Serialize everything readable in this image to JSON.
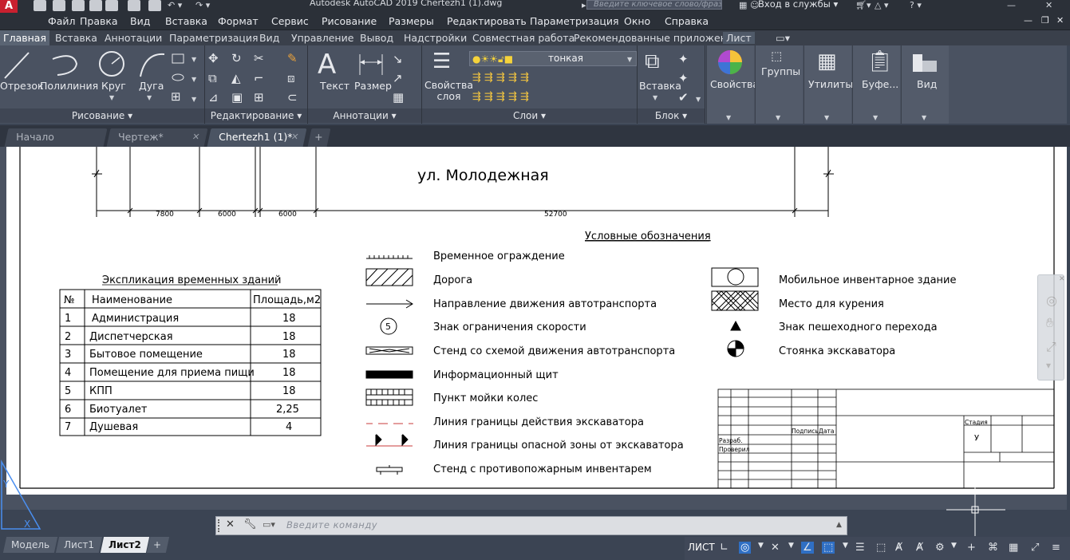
{
  "titlebar": {
    "app_logo": "A",
    "title": "Autodesk AutoCAD 2019    Chertezh1 (1).dwg",
    "search_placeholder": "Введите ключевое слово/фразу",
    "login": "Вход в службы"
  },
  "menu": [
    "Файл",
    "Правка",
    "Вид",
    "Вставка",
    "Формат",
    "Сервис",
    "Рисование",
    "Размеры",
    "Редактировать",
    "Параметризация",
    "Окно",
    "Справка"
  ],
  "ribbon_tabs": [
    "Главная",
    "Вставка",
    "Аннотации",
    "Параметризация",
    "Вид",
    "Управление",
    "Вывод",
    "Надстройки",
    "Совместная работа",
    "Рекомендованные приложения",
    "Лист"
  ],
  "ribbon": {
    "draw_buttons": [
      "Отрезок",
      "Полилиния",
      "Круг",
      "Дуга"
    ],
    "text_label": "Текст",
    "dimension_label": "Размер",
    "layer_properties": "Свойства\nслоя",
    "layer_current": "тонкая",
    "insert_label": "Вставка",
    "properties_label": "Свойства",
    "groups_label": "Группы",
    "utilities_label": "Утилиты",
    "clipboard_label": "Буфе...",
    "view_label": "Вид",
    "panels": {
      "draw": "Рисование",
      "modify": "Редактирование",
      "annotation": "Аннотации",
      "layers": "Слои",
      "block": "Блок"
    }
  },
  "doc_tabs": [
    {
      "label": "Начало",
      "active": false
    },
    {
      "label": "Чертеж*",
      "active": false
    },
    {
      "label": "Chertezh1 (1)*",
      "active": true
    }
  ],
  "drawing": {
    "street": "ул. Молодежная",
    "dims": [
      "7800",
      "6000",
      "6000",
      "52700"
    ],
    "legend_title": "Условные обозначения",
    "legend_left": [
      "Временное ограждение",
      "Дорога",
      "Направление движения автотранспорта",
      "Знак ограничения скорости",
      "Стенд со схемой движения автотранспорта",
      "Информационный щит",
      "Пункт мойки колес",
      "Линия границы действия экскаватора",
      "Линия границы опасной зоны от экскаватора",
      "Стенд с противопожарным инвентарем"
    ],
    "legend_right": [
      "Мобильное инвентарное здание",
      "Место для курения",
      "Знак пешеходного перехода",
      "Стоянка экскаватора"
    ],
    "speed_sign": "5",
    "explication_title": "Экспликация временных зданий",
    "explication_headers": [
      "№",
      "Наименование",
      "Площадь,м2"
    ],
    "explication_rows": [
      [
        "1",
        "Администрация",
        "18"
      ],
      [
        "2",
        "Диспетчерская",
        "18"
      ],
      [
        "3",
        "Бытовое помещение",
        "18"
      ],
      [
        "4",
        "Помещение для приема пищи",
        "18"
      ],
      [
        "5",
        "КПП",
        "18"
      ],
      [
        "6",
        "Биотуалет",
        "2,25"
      ],
      [
        "7",
        "Душевая",
        "4"
      ]
    ],
    "stamp": {
      "podpis": "Подпись",
      "data": "Дата",
      "razrab": "Разраб.",
      "proveril": "Проверил",
      "stadia": "Стадия",
      "stadia_value": "У"
    }
  },
  "command": {
    "placeholder": "Введите команду"
  },
  "layout_tabs": [
    {
      "label": "Модель",
      "active": false
    },
    {
      "label": "Лист1",
      "active": false
    },
    {
      "label": "Лист2",
      "active": true
    }
  ],
  "status": {
    "mode": "ЛИСТ"
  }
}
